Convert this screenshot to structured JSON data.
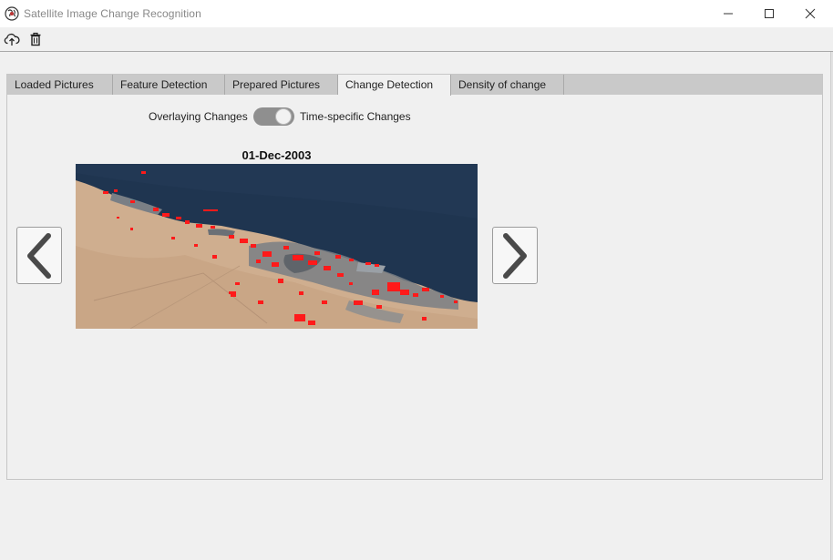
{
  "window": {
    "title": "Satellite Image Change Recognition"
  },
  "toolbar": {
    "upload_icon": "cloud-upload-icon",
    "delete_icon": "trash-icon"
  },
  "tabs": [
    {
      "label": "Loaded Pictures",
      "active": false
    },
    {
      "label": "Feature Detection",
      "active": false
    },
    {
      "label": "Prepared Pictures",
      "active": false
    },
    {
      "label": "Change Detection",
      "active": true
    },
    {
      "label": "Density of change",
      "active": false
    }
  ],
  "change_detection": {
    "toggle_left_label": "Overlaying Changes",
    "toggle_right_label": "Time-specific Changes",
    "toggle_state": "Time-specific Changes",
    "date": "01-Dec-2003",
    "prev_icon": "chevron-left-icon",
    "next_icon": "chevron-right-icon"
  },
  "colors": {
    "change_marker": "#ff1a1a",
    "sea": "#1f3550",
    "land": "#cfae8f",
    "urban": "#7a7f85"
  }
}
